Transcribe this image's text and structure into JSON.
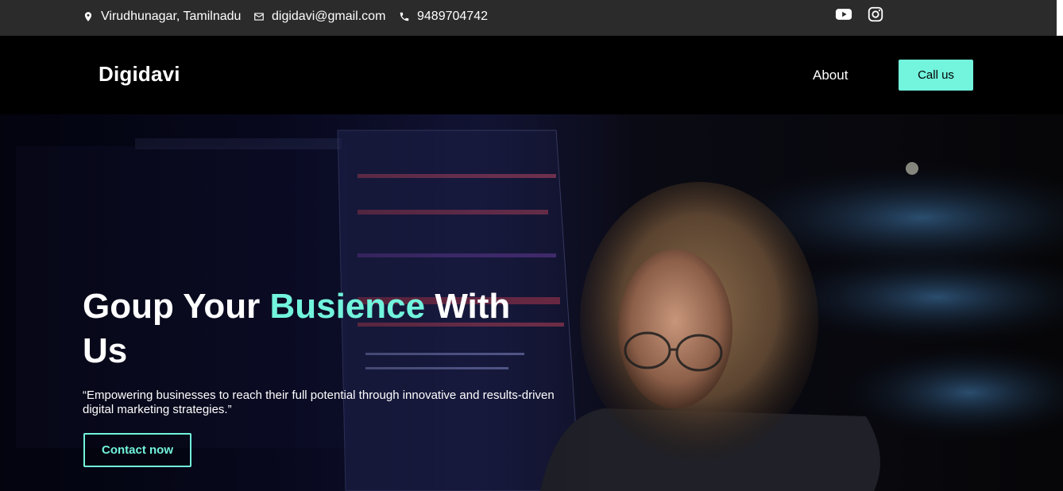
{
  "topbar": {
    "location": "Virudhunagar, Tamilnadu",
    "email": "digidavi@gmail.com",
    "phone": "9489704742",
    "icons": [
      "location-pin-icon",
      "mail-icon",
      "phone-icon",
      "youtube-icon",
      "instagram-icon"
    ]
  },
  "header": {
    "logo": "Digidavi",
    "nav_about": "About",
    "call_button": "Call us"
  },
  "hero": {
    "headline_part1": "Goup Your ",
    "headline_accent": "Busience",
    "headline_part2": " With Us",
    "tagline": "“Empowering businesses to reach their full potential through innovative and results-driven digital marketing strategies.”",
    "contact_button": "Contact now"
  },
  "colors": {
    "accent": "#72f4dd",
    "topbar_bg": "#2b2b2b",
    "header_bg": "#000000"
  }
}
